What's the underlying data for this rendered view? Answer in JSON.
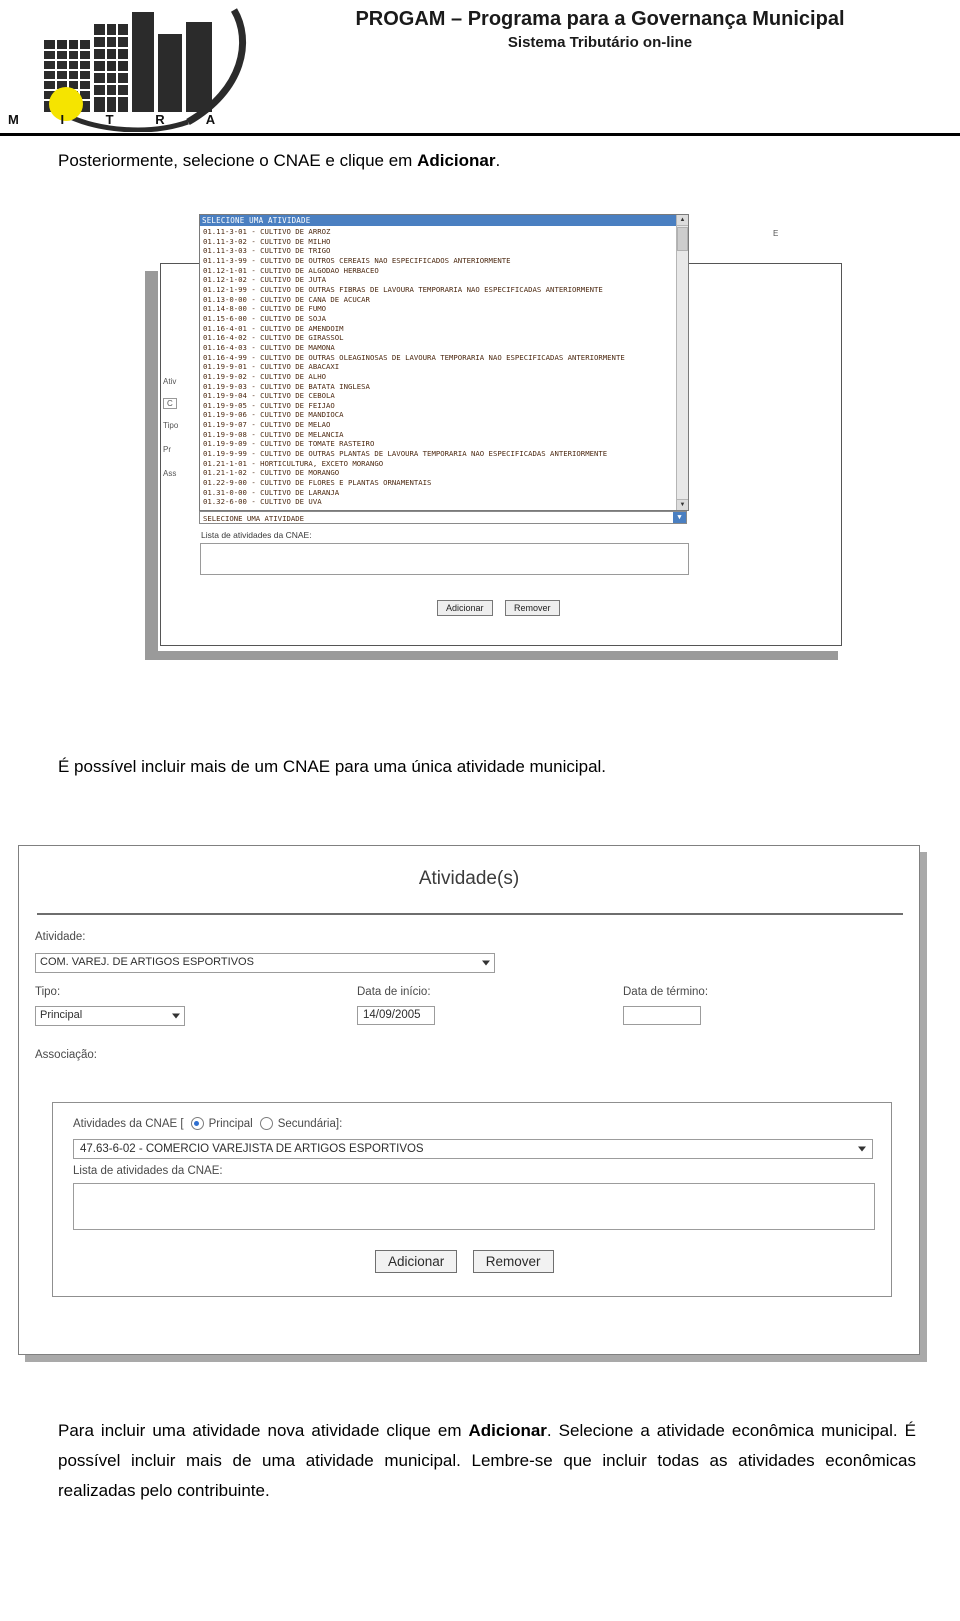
{
  "header": {
    "title_main": "PROGAM – Programa para a Governança Municipal",
    "title_sub": "Sistema Tributário on-line",
    "logo_label": "M I T R A"
  },
  "paragraphs": {
    "top_plain_1": "Posteriormente, selecione o CNAE e clique em ",
    "top_bold_1": "Adicionar",
    "top_plain_2": ".",
    "middle": "É possível incluir mais de um CNAE para uma única atividade municipal.",
    "bottom_1": "Para incluir uma atividade nova atividade clique em ",
    "bottom_bold_1": "Adicionar",
    "bottom_2": ". Selecione a atividade econômica municipal. É possível incluir mais de uma atividade municipal. Lembre-se que incluir todas as atividades econômicas realizadas pelo contribuinte."
  },
  "figure1": {
    "listbox_title": "SELECIONE UMA ATIVIDADE",
    "items": [
      "01.11-3-01 - CULTIVO DE ARROZ",
      "01.11-3-02 - CULTIVO DE MILHO",
      "01.11-3-03 - CULTIVO DE TRIGO",
      "01.11-3-99 - CULTIVO DE OUTROS CEREAIS NAO ESPECIFICADOS ANTERIORMENTE",
      "01.12-1-01 - CULTIVO DE ALGODAO HERBACEO",
      "01.12-1-02 - CULTIVO DE JUTA",
      "01.12-1-99 - CULTIVO DE OUTRAS FIBRAS DE LAVOURA TEMPORARIA NAO ESPECIFICADAS ANTERIORMENTE",
      "01.13-0-00 - CULTIVO DE CANA DE ACUCAR",
      "01.14-8-00 - CULTIVO DE FUMO",
      "01.15-6-00 - CULTIVO DE SOJA",
      "01.16-4-01 - CULTIVO DE AMENDOIM",
      "01.16-4-02 - CULTIVO DE GIRASSOL",
      "01.16-4-03 - CULTIVO DE MAMONA",
      "01.16-4-99 - CULTIVO DE OUTRAS OLEAGINOSAS DE LAVOURA TEMPORARIA NAO ESPECIFICADAS ANTERIORMENTE",
      "01.19-9-01 - CULTIVO DE ABACAXI",
      "01.19-9-02 - CULTIVO DE ALHO",
      "01.19-9-03 - CULTIVO DE BATATA INGLESA",
      "01.19-9-04 - CULTIVO DE CEBOLA",
      "01.19-9-05 - CULTIVO DE FEIJAO",
      "01.19-9-06 - CULTIVO DE MANDIOCA",
      "01.19-9-07 - CULTIVO DE MELAO",
      "01.19-9-08 - CULTIVO DE MELANCIA",
      "01.19-9-09 - CULTIVO DE TOMATE RASTEIRO",
      "01.19-9-99 - CULTIVO DE OUTRAS PLANTAS DE LAVOURA TEMPORARIA NAO ESPECIFICADAS ANTERIORMENTE",
      "01.21-1-01 - HORTICULTURA, EXCETO MORANGO",
      "01.21-1-02 - CULTIVO DE MORANGO",
      "01.22-9-00 - CULTIVO DE FLORES E PLANTAS ORNAMENTAIS",
      "01.31-0-00 - CULTIVO DE LARANJA",
      "01.32-6-00 - CULTIVO DE UVA"
    ],
    "combo_selected": "SELECIONE UMA ATIVIDADE",
    "list_label": "Lista de atividades da CNAE:",
    "textarea_value": "",
    "btn_add": "Adicionar",
    "btn_remove": "Remover",
    "ghost_labels": [
      "Ativ",
      "C",
      "Tipo",
      "Pr",
      "Ass",
      "E"
    ]
  },
  "figure2": {
    "title": "Atividade(s)",
    "label_atividade": "Atividade:",
    "atividade_value": "COM. VAREJ. DE ARTIGOS ESPORTIVOS",
    "label_tipo": "Tipo:",
    "tipo_value": "Principal",
    "label_data_inicio": "Data de início:",
    "data_inicio_value": "14/09/2005",
    "label_data_termino": "Data de término:",
    "data_termino_value": "",
    "label_associacao": "Associação:",
    "radio_group_prefix": "Atividades da CNAE [",
    "radio_principal": "Principal",
    "radio_secundaria": "Secundária",
    "radio_group_suffix": "]:",
    "radio_selected": "Principal",
    "cnae_value": "47.63-6-02 - COMERCIO VAREJISTA DE ARTIGOS ESPORTIVOS",
    "label_lista_cnae": "Lista de atividades da CNAE:",
    "textarea_value": "",
    "btn_add": "Adicionar",
    "btn_remove": "Remover"
  }
}
